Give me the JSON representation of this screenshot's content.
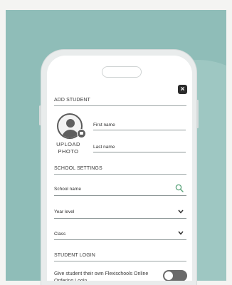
{
  "form": {
    "add_student_heading": "ADD STUDENT",
    "close_icon": "×",
    "upload_photo_line1": "UPLOAD",
    "upload_photo_line2": "PHOTO",
    "first_name_label": "First name",
    "last_name_label": "Last name",
    "school_settings_heading": "SCHOOL SETTINGS",
    "school_name_label": "School name",
    "year_level_label": "Year level",
    "class_label": "Class",
    "student_login_heading": "STUDENT LOGIN",
    "login_toggle_text": "Give student their own Flexischools Online Ordering Login",
    "login_toggle_on": false
  },
  "colors": {
    "backdrop": "#8fbdb8",
    "search_icon": "#5aa37a"
  },
  "icons": [
    "close-icon",
    "avatar-icon",
    "camera-icon",
    "search-icon",
    "chevron-down-icon"
  ]
}
